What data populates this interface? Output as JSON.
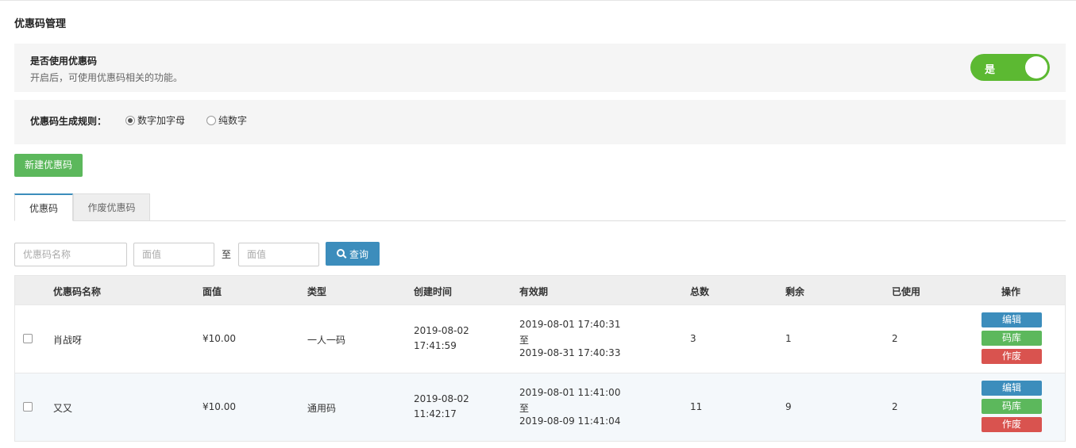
{
  "page": {
    "title": "优惠码管理"
  },
  "toggle_panel": {
    "title": "是否使用优惠码",
    "description": "开启后，可使用优惠码相关的功能。",
    "switch_label": "是",
    "switch_on": true
  },
  "rule_panel": {
    "label": "优惠码生成规则：",
    "options": [
      {
        "label": "数字加字母",
        "checked": true
      },
      {
        "label": "纯数字",
        "checked": false
      }
    ]
  },
  "new_button": {
    "label": "新建优惠码"
  },
  "tabs": [
    {
      "label": "优惠码",
      "active": true
    },
    {
      "label": "作废优惠码",
      "active": false
    }
  ],
  "filters": {
    "name_placeholder": "优惠码名称",
    "value_from_placeholder": "面值",
    "to_label": "至",
    "value_to_placeholder": "面值",
    "search_label": "查询",
    "search_icon": "search-icon"
  },
  "table": {
    "headers": {
      "name": "优惠码名称",
      "value": "面值",
      "type": "类型",
      "created": "创建时间",
      "validity": "有效期",
      "total": "总数",
      "remaining": "剩余",
      "used": "已使用",
      "actions": "操作"
    },
    "rows": [
      {
        "name": "肖战呀",
        "value": "¥10.00",
        "type": "一人一码",
        "created_date": "2019-08-02",
        "created_time": "17:41:59",
        "valid_from": "2019-08-01 17:40:31",
        "valid_sep": "至",
        "valid_to": "2019-08-31 17:40:33",
        "total": "3",
        "remaining": "1",
        "used": "2"
      },
      {
        "name": "又又",
        "value": "¥10.00",
        "type": "通用码",
        "created_date": "2019-08-02",
        "created_time": "11:42:17",
        "valid_from": "2019-08-01 11:41:00",
        "valid_sep": "至",
        "valid_to": "2019-08-09 11:41:04",
        "total": "11",
        "remaining": "9",
        "used": "2"
      }
    ],
    "actions": {
      "edit": "编辑",
      "library": "码库",
      "void": "作废"
    }
  },
  "colors": {
    "primary": "#3c8dbc",
    "success": "#5cb85c",
    "danger": "#d9534f",
    "switch_on": "#5cb932"
  }
}
